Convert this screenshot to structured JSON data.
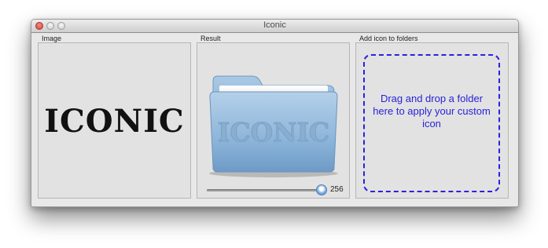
{
  "window": {
    "title": "Iconic"
  },
  "image_panel": {
    "label": "Image",
    "preview_text": "ICONIC"
  },
  "result_panel": {
    "label": "Result",
    "folder_text": "ICONIC",
    "size_value": "256",
    "size_level": 1.0
  },
  "add_panel": {
    "label": "Add icon to folders",
    "drop_text": "Drag and drop a folder here to apply your custom icon"
  },
  "icons": {
    "close": "close-button-icon",
    "minimize": "minimize-button-icon",
    "zoom": "zoom-button-icon",
    "folder": "folder-icon"
  },
  "colors": {
    "drop_border": "#2f1fe0",
    "drop_text": "#2a22d8",
    "folder": "#8eb6d8"
  }
}
